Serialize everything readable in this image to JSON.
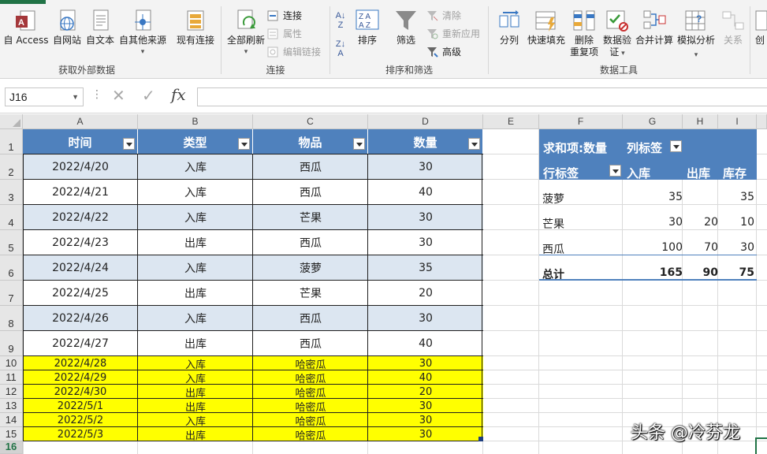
{
  "ribbon": {
    "groups": [
      {
        "label": "获取外部数据",
        "buttons": [
          "自 Access",
          "自网站",
          "自文本",
          "自其他来源",
          "现有连接"
        ]
      },
      {
        "label": "连接",
        "buttons": [
          "全部刷新",
          "连接",
          "属性",
          "编辑链接"
        ]
      },
      {
        "label": "排序和筛选",
        "buttons": [
          "排序",
          "筛选",
          "清除",
          "重新应用",
          "高级"
        ]
      },
      {
        "label": "数据工具",
        "buttons": [
          "分列",
          "快速填充",
          "删除重复项",
          "数据验证",
          "合并计算",
          "模拟分析",
          "关系"
        ]
      }
    ],
    "existing_conn": "现有连接",
    "refresh_all": "全部刷新",
    "delete_dup_1": "删除",
    "delete_dup_2": "重复项",
    "validate_1": "数据验",
    "validate_2": "证",
    "more": "创"
  },
  "formula_bar": {
    "name_box": "J16",
    "fx": "fx",
    "formula": ""
  },
  "columns": [
    "A",
    "B",
    "C",
    "D",
    "E",
    "F",
    "G",
    "H",
    "I"
  ],
  "rows": [
    "1",
    "2",
    "3",
    "4",
    "5",
    "6",
    "7",
    "8",
    "9",
    "10",
    "11",
    "12",
    "13",
    "14",
    "15",
    "16"
  ],
  "table": {
    "headers": [
      "时间",
      "类型",
      "物品",
      "数量"
    ],
    "rows": [
      [
        "2022/4/20",
        "入库",
        "西瓜",
        "30"
      ],
      [
        "2022/4/21",
        "入库",
        "西瓜",
        "40"
      ],
      [
        "2022/4/22",
        "入库",
        "芒果",
        "30"
      ],
      [
        "2022/4/23",
        "出库",
        "西瓜",
        "30"
      ],
      [
        "2022/4/24",
        "入库",
        "菠萝",
        "35"
      ],
      [
        "2022/4/25",
        "出库",
        "芒果",
        "20"
      ],
      [
        "2022/4/26",
        "入库",
        "西瓜",
        "30"
      ],
      [
        "2022/4/27",
        "出库",
        "西瓜",
        "40"
      ],
      [
        "2022/4/28",
        "入库",
        "哈密瓜",
        "30"
      ],
      [
        "2022/4/29",
        "入库",
        "哈密瓜",
        "40"
      ],
      [
        "2022/4/30",
        "出库",
        "哈密瓜",
        "20"
      ],
      [
        "2022/5/1",
        "出库",
        "哈密瓜",
        "30"
      ],
      [
        "2022/5/2",
        "入库",
        "哈密瓜",
        "30"
      ],
      [
        "2022/5/3",
        "出库",
        "哈密瓜",
        "30"
      ]
    ],
    "highlight_color": "#ffff00",
    "header_color": "#4f81bd",
    "band_color": "#dce6f1"
  },
  "pivot": {
    "value_label": "求和项:数量",
    "col_label": "列标签",
    "row_label": "行标签",
    "col_headers": [
      "入库",
      "出库",
      "库存"
    ],
    "rows": [
      {
        "name": "菠萝",
        "in": "35",
        "out": "",
        "stock": "35"
      },
      {
        "name": "芒果",
        "in": "30",
        "out": "20",
        "stock": "10"
      },
      {
        "name": "西瓜",
        "in": "100",
        "out": "70",
        "stock": "30"
      }
    ],
    "total": {
      "name": "总计",
      "in": "165",
      "out": "90",
      "stock": "75"
    }
  },
  "watermark": "头条 @冷芬龙"
}
